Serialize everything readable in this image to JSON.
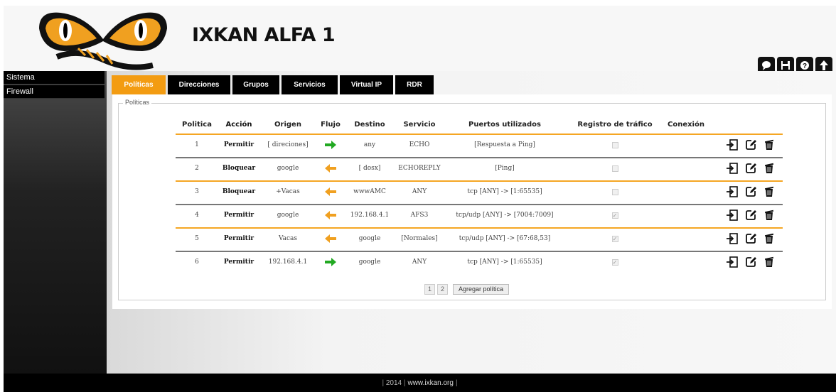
{
  "header": {
    "title": "IXKAN ALFA 1"
  },
  "sidebar": {
    "items": [
      {
        "label": "Sistema"
      },
      {
        "label": "Firewall"
      }
    ]
  },
  "tabs": [
    {
      "label": "Políticas",
      "active": true
    },
    {
      "label": "Direcciones"
    },
    {
      "label": "Grupos"
    },
    {
      "label": "Servicios"
    },
    {
      "label": "Virtual IP"
    },
    {
      "label": "RDR"
    }
  ],
  "panel": {
    "legend": "Políticas",
    "columns": {
      "num": "Politica",
      "accion": "Acción",
      "origen": "Origen",
      "flujo": "Flujo",
      "destino": "Destino",
      "servicio": "Servicio",
      "puertos": "Puertos utilizados",
      "registro": "Registro de tráfico",
      "conexion": "Conexión"
    },
    "rows": [
      {
        "num": "1",
        "accion": "Permitir",
        "origen": "[ direciones]",
        "flujo": "right",
        "destino": "any",
        "servicio": "ECHO",
        "puertos": "[Respuesta a Ping]",
        "registro": false
      },
      {
        "num": "2",
        "accion": "Bloquear",
        "origen": "google",
        "flujo": "left",
        "destino": "[ dosx]",
        "servicio": "ECHOREPLY",
        "puertos": "[Ping]",
        "registro": false
      },
      {
        "num": "3",
        "accion": "Bloquear",
        "origen": "+Vacas",
        "flujo": "left",
        "destino": "wwwAMC",
        "servicio": "ANY",
        "puertos": "tcp [ANY] -> [1:65535]",
        "registro": false
      },
      {
        "num": "4",
        "accion": "Permitir",
        "origen": "google",
        "flujo": "left",
        "destino": "192.168.4.1",
        "servicio": "AFS3",
        "puertos": "tcp/udp [ANY] -> [7004:7009]",
        "registro": true
      },
      {
        "num": "5",
        "accion": "Permitir",
        "origen": "Vacas",
        "flujo": "left",
        "destino": "google",
        "servicio": "[Normales]",
        "puertos": "tcp/udp [ANY] -> [67:68,53]",
        "registro": true
      },
      {
        "num": "6",
        "accion": "Permitir",
        "origen": "192.168.4.1",
        "flujo": "right",
        "destino": "google",
        "servicio": "ANY",
        "puertos": "tcp [ANY] -> [1:65535]",
        "registro": true
      }
    ],
    "pager": [
      "1",
      "2"
    ],
    "add_label": "Agregar política"
  },
  "footer": {
    "year": "2014",
    "link": "www.ixkan.org"
  },
  "colors": {
    "accent": "#f39c12",
    "arrow_right": "#22a922",
    "arrow_left": "#f0a020"
  }
}
